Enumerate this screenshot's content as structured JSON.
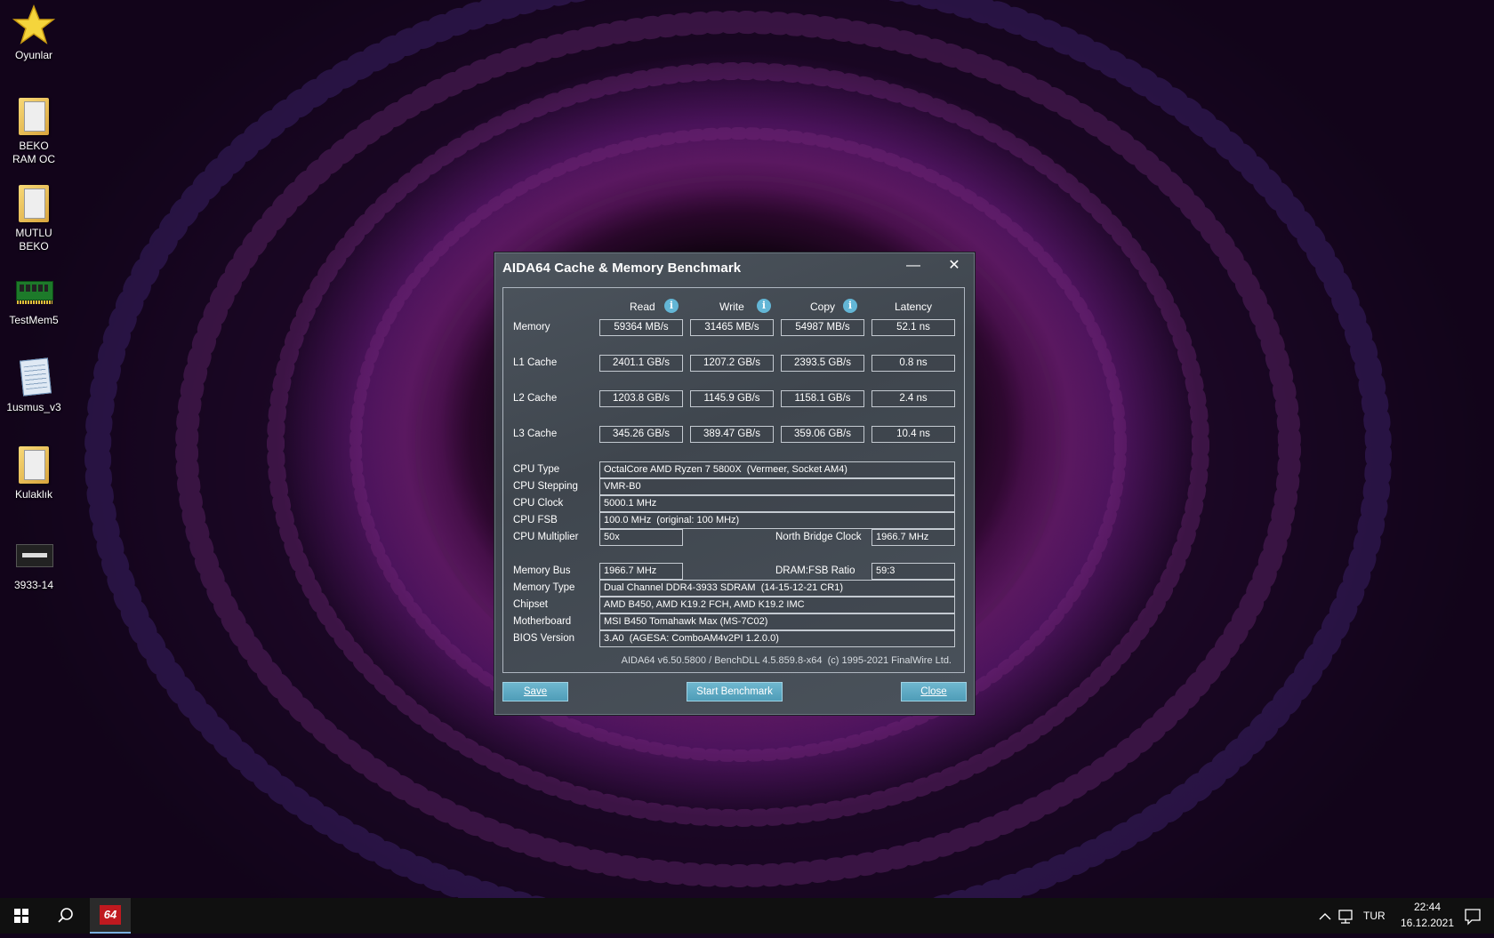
{
  "desktop": {
    "icons": [
      {
        "label": "Oyunlar",
        "icon": "star-icon"
      },
      {
        "label": "BEKO RAM OC",
        "icon": "folder-icon"
      },
      {
        "label": "MUTLU BEKO",
        "icon": "folder-icon"
      },
      {
        "label": "TestMem5",
        "icon": "ram-module-icon"
      },
      {
        "label": "1usmus_v3",
        "icon": "notepad-icon"
      },
      {
        "label": "Kulaklık",
        "icon": "folder-icon"
      },
      {
        "label": "3933-14",
        "icon": "image-thumbnail-icon"
      }
    ]
  },
  "dialog": {
    "title": "AIDA64 Cache & Memory Benchmark",
    "minimize_glyph": "—",
    "close_glyph": "✕",
    "columns": {
      "read": "Read",
      "write": "Write",
      "copy": "Copy",
      "latency": "Latency",
      "info_glyph": "i"
    },
    "rows": [
      {
        "label": "Memory",
        "read": "59364 MB/s",
        "write": "31465 MB/s",
        "copy": "54987 MB/s",
        "latency": "52.1 ns"
      },
      {
        "label": "L1 Cache",
        "read": "2401.1 GB/s",
        "write": "1207.2 GB/s",
        "copy": "2393.5 GB/s",
        "latency": "0.8 ns"
      },
      {
        "label": "L2 Cache",
        "read": "1203.8 GB/s",
        "write": "1145.9 GB/s",
        "copy": "1158.1 GB/s",
        "latency": "2.4 ns"
      },
      {
        "label": "L3 Cache",
        "read": "345.26 GB/s",
        "write": "389.47 GB/s",
        "copy": "359.06 GB/s",
        "latency": "10.4 ns"
      }
    ],
    "info": {
      "cpu_type_label": "CPU Type",
      "cpu_type": "OctalCore AMD Ryzen 7 5800X  (Vermeer, Socket AM4)",
      "cpu_stepping_label": "CPU Stepping",
      "cpu_stepping": "VMR-B0",
      "cpu_clock_label": "CPU Clock",
      "cpu_clock": "5000.1 MHz",
      "cpu_fsb_label": "CPU FSB",
      "cpu_fsb": "100.0 MHz  (original: 100 MHz)",
      "cpu_multiplier_label": "CPU Multiplier",
      "cpu_multiplier": "50x",
      "nb_clock_label": "North Bridge Clock",
      "nb_clock": "1966.7 MHz",
      "memory_bus_label": "Memory Bus",
      "memory_bus": "1966.7 MHz",
      "dram_fsb_label": "DRAM:FSB Ratio",
      "dram_fsb": "59:3",
      "memory_type_label": "Memory Type",
      "memory_type": "Dual Channel DDR4-3933 SDRAM  (14-15-12-21 CR1)",
      "chipset_label": "Chipset",
      "chipset": "AMD B450, AMD K19.2 FCH, AMD K19.2 IMC",
      "motherboard_label": "Motherboard",
      "motherboard": "MSI B450 Tomahawk Max (MS-7C02)",
      "bios_label": "BIOS Version",
      "bios": "3.A0  (AGESA: ComboAM4v2PI 1.2.0.0)"
    },
    "footer": "AIDA64 v6.50.5800 / BenchDLL 4.5.859.8-x64  (c) 1995-2021 FinalWire Ltd.",
    "buttons": {
      "save": "Save",
      "start": "Start Benchmark",
      "close": "Close"
    }
  },
  "taskbar": {
    "search_icon": "search-icon",
    "pinned_app": "64",
    "language": "TUR",
    "time": "22:44",
    "date": "16.12.2021"
  }
}
